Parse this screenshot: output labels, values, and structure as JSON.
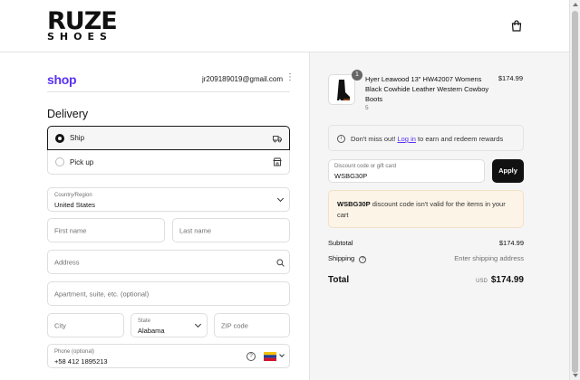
{
  "brand": {
    "line1": "RUZE",
    "line2": "SHOES"
  },
  "contact": {
    "shop_label": "shop",
    "email": "jr209189019@gmail.com"
  },
  "delivery": {
    "title": "Delivery",
    "options": [
      {
        "label": "Ship",
        "selected": true
      },
      {
        "label": "Pick up",
        "selected": false
      }
    ]
  },
  "form": {
    "country_label": "Country/Region",
    "country_value": "United States",
    "first_name_placeholder": "First name",
    "last_name_placeholder": "Last name",
    "address_placeholder": "Address",
    "apartment_placeholder": "Apartment, suite, etc. (optional)",
    "city_placeholder": "City",
    "state_label": "State",
    "state_value": "Alabama",
    "zip_placeholder": "ZIP code",
    "phone_label": "Phone (optional)",
    "phone_value": "+58 412 1895213"
  },
  "order": {
    "item": {
      "quantity": "1",
      "name": "Hyer Leawood 13\" HW42007 Womens Black Cowhide Leather Western Cowboy Boots",
      "variant": "5",
      "price": "$174.99"
    },
    "rewards_text_pre": "Don't miss out!",
    "rewards_link": "Log in",
    "rewards_text_post": "to earn and redeem rewards",
    "discount_label": "Discount code or gift card",
    "discount_value": "WSBG30P",
    "apply_label": "Apply",
    "warning_code": "WSBG30P",
    "warning_text": "discount code isn't valid for the items in your cart",
    "subtotal_label": "Subtotal",
    "subtotal_value": "$174.99",
    "shipping_label": "Shipping",
    "shipping_value": "Enter shipping address",
    "total_label": "Total",
    "total_currency": "USD",
    "total_value": "$174.99"
  },
  "colors": {
    "shop_accent": "#5a31f4",
    "warning_bg": "#fdf4e8",
    "button": "#111111"
  },
  "icons": [
    "shopping-bag-icon",
    "more-vertical-icon",
    "truck-icon",
    "store-icon",
    "chevron-down-icon",
    "search-icon",
    "help-circle-icon",
    "venezuela-flag-icon",
    "info-icon"
  ]
}
